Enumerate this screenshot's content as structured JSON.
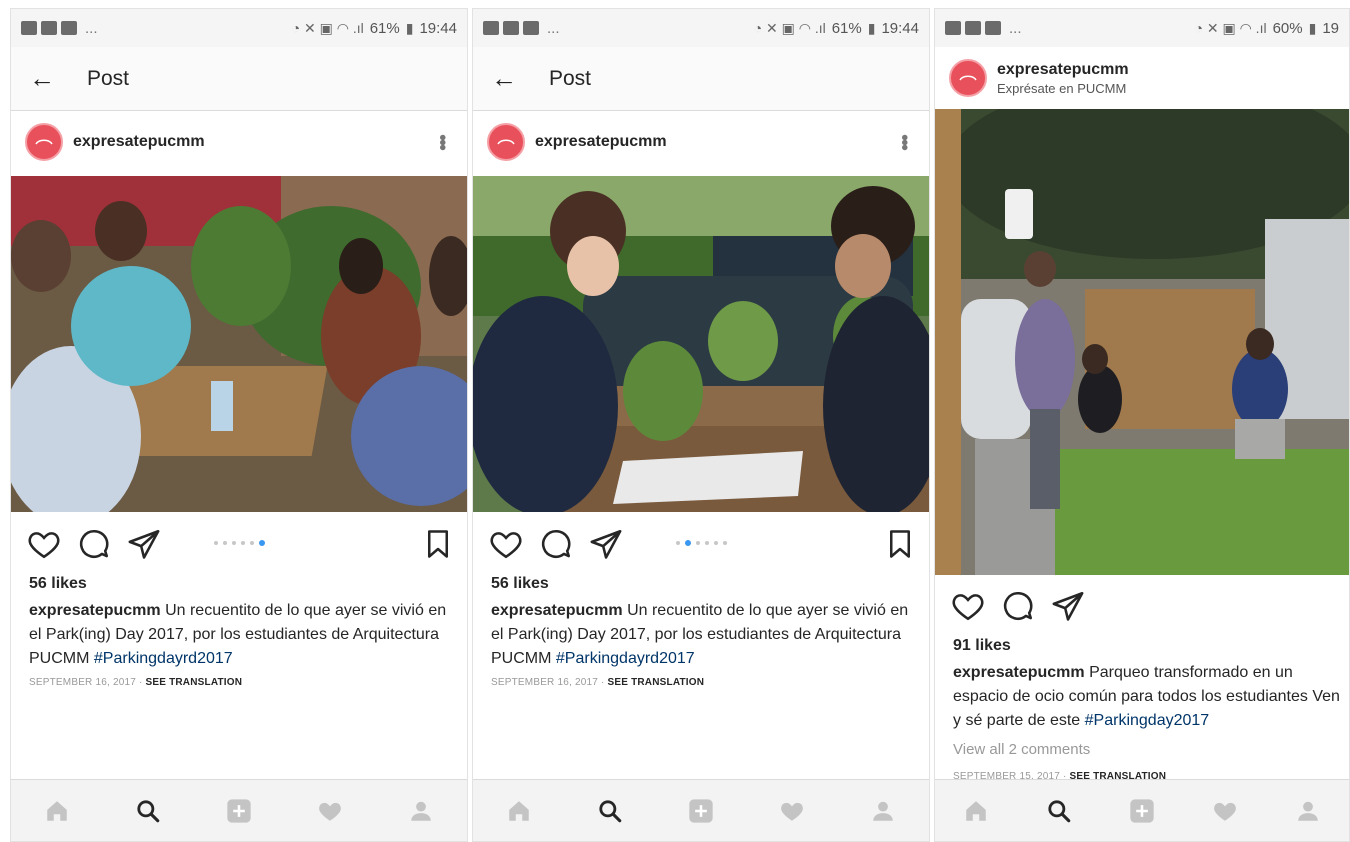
{
  "status_bars": [
    {
      "battery": "61%",
      "time": "19:44"
    },
    {
      "battery": "61%",
      "time": "19:44"
    },
    {
      "battery": "60%",
      "time": "19"
    }
  ],
  "posts": [
    {
      "header_title": "Post",
      "username": "expresatepucmm",
      "likes": "56 likes",
      "caption_user": "expresatepucmm",
      "caption_text": " Un recuentito de lo que ayer se vivió en el Park(ing) Day 2017, por los estudiantes de Arquitectura PUCMM ",
      "hashtag": "#Parkingdayrd2017",
      "date": "SEPTEMBER 16, 2017",
      "translation": "SEE TRANSLATION",
      "carousel_total": 6,
      "carousel_active": 5
    },
    {
      "header_title": "Post",
      "username": "expresatepucmm",
      "likes": "56 likes",
      "caption_user": "expresatepucmm",
      "caption_text": " Un recuentito de lo que ayer se vivió en el Park(ing) Day 2017, por los estudiantes de Arquitectura PUCMM ",
      "hashtag": "#Parkingdayrd2017",
      "date": "SEPTEMBER 16, 2017",
      "translation": "SEE TRANSLATION",
      "carousel_total": 6,
      "carousel_active": 1
    },
    {
      "username": "expresatepucmm",
      "location": "Exprésate en PUCMM",
      "likes": "91 likes",
      "caption_user": "expresatepucmm",
      "caption_text": " Parqueo transformado en un espacio de ocio común para todos los estudiantes Ven y sé parte de este ",
      "hashtag": "#Parkingday2017",
      "comments_link": "View all 2 comments",
      "date": "SEPTEMBER 15, 2017",
      "translation": "SEE TRANSLATION"
    }
  ],
  "colors": {
    "accent": "#3897f0",
    "hashtag": "#003569",
    "avatar": "#e8505b"
  },
  "icons": [
    "back-arrow-icon",
    "more-icon",
    "heart-icon",
    "comment-icon",
    "share-icon",
    "bookmark-icon",
    "home-icon",
    "search-icon",
    "add-icon",
    "activity-icon",
    "profile-icon"
  ]
}
